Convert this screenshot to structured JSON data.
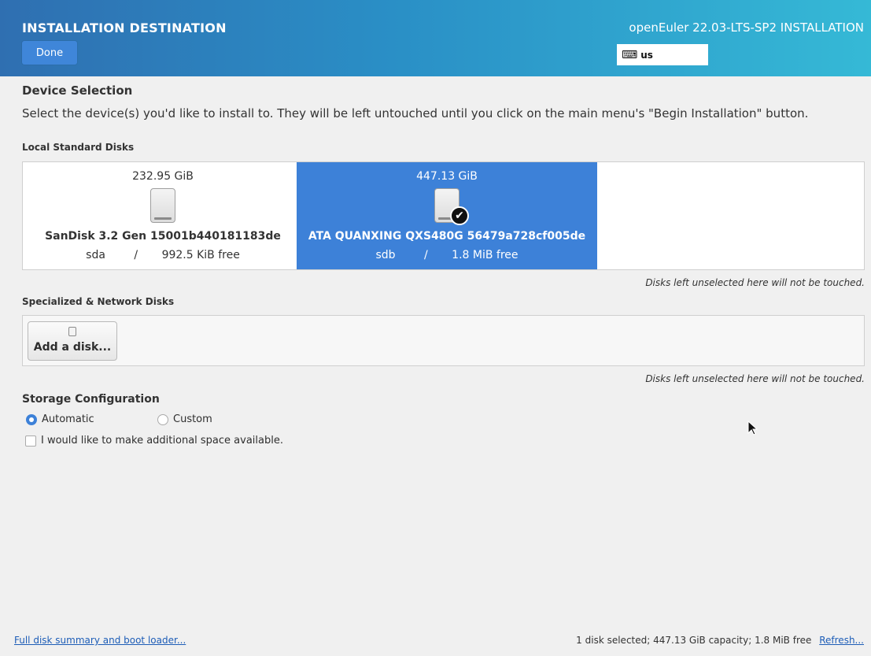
{
  "header": {
    "title": "INSTALLATION DESTINATION",
    "done_label": "Done",
    "product": "openEuler 22.03-LTS-SP2 INSTALLATION",
    "keyboard_layout": "us"
  },
  "device_selection": {
    "title": "Device Selection",
    "description": "Select the device(s) you'd like to install to.  They will be left untouched until you click on the main menu's \"Begin Installation\" button."
  },
  "local_disks": {
    "heading": "Local Standard Disks",
    "disks": [
      {
        "size": "232.95 GiB",
        "name": "SanDisk 3.2 Gen 15001b440181183de",
        "device": "sda",
        "separator": "/",
        "free": "992.5 KiB free",
        "selected": false
      },
      {
        "size": "447.13 GiB",
        "name": "ATA QUANXING QXS480G 56479a728cf005de",
        "device": "sdb",
        "separator": "/",
        "free": "1.8 MiB free",
        "selected": true
      }
    ],
    "note": "Disks left unselected here will not be touched."
  },
  "specialized": {
    "heading": "Specialized & Network Disks",
    "add_label": "Add a disk...",
    "note": "Disks left unselected here will not be touched."
  },
  "storage": {
    "title": "Storage Configuration",
    "automatic": "Automatic",
    "custom": "Custom",
    "selected": "Automatic",
    "additional_space": "I would like to make additional space available."
  },
  "footer": {
    "summary_link": "Full disk summary and boot loader...",
    "status": "1 disk selected; 447.13 GiB capacity; 1.8 MiB free",
    "refresh": "Refresh..."
  },
  "colors": {
    "accent": "#3d81d8",
    "header_start": "#2f6fb1",
    "header_end": "#35b9d6"
  }
}
